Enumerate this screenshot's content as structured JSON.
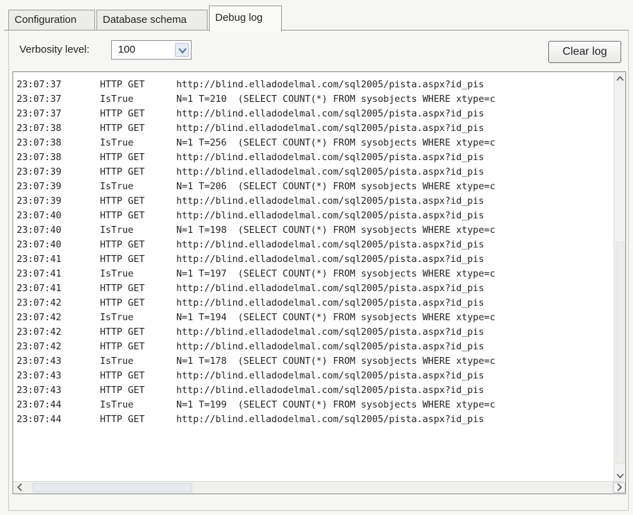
{
  "tabs": [
    {
      "label": "Configuration"
    },
    {
      "label": "Database schema"
    },
    {
      "label": "Debug log"
    }
  ],
  "verbosity": {
    "label": "Verbosity level:",
    "value": "100"
  },
  "clear_button": {
    "label": "Clear log"
  },
  "log": [
    {
      "time": "23:07:37",
      "kind": "HTTP GET",
      "msg": "http://blind.elladodelmal.com/sql2005/pista.aspx?id_pis"
    },
    {
      "time": "23:07:37",
      "kind": "IsTrue",
      "msg": "N=1 T=210  (SELECT COUNT(*) FROM sysobjects WHERE xtype=c"
    },
    {
      "time": "23:07:37",
      "kind": "HTTP GET",
      "msg": "http://blind.elladodelmal.com/sql2005/pista.aspx?id_pis"
    },
    {
      "time": "23:07:38",
      "kind": "HTTP GET",
      "msg": "http://blind.elladodelmal.com/sql2005/pista.aspx?id_pis"
    },
    {
      "time": "23:07:38",
      "kind": "IsTrue",
      "msg": "N=1 T=256  (SELECT COUNT(*) FROM sysobjects WHERE xtype=c"
    },
    {
      "time": "23:07:38",
      "kind": "HTTP GET",
      "msg": "http://blind.elladodelmal.com/sql2005/pista.aspx?id_pis"
    },
    {
      "time": "23:07:39",
      "kind": "HTTP GET",
      "msg": "http://blind.elladodelmal.com/sql2005/pista.aspx?id_pis"
    },
    {
      "time": "23:07:39",
      "kind": "IsTrue",
      "msg": "N=1 T=206  (SELECT COUNT(*) FROM sysobjects WHERE xtype=c"
    },
    {
      "time": "23:07:39",
      "kind": "HTTP GET",
      "msg": "http://blind.elladodelmal.com/sql2005/pista.aspx?id_pis"
    },
    {
      "time": "23:07:40",
      "kind": "HTTP GET",
      "msg": "http://blind.elladodelmal.com/sql2005/pista.aspx?id_pis"
    },
    {
      "time": "23:07:40",
      "kind": "IsTrue",
      "msg": "N=1 T=198  (SELECT COUNT(*) FROM sysobjects WHERE xtype=c"
    },
    {
      "time": "23:07:40",
      "kind": "HTTP GET",
      "msg": "http://blind.elladodelmal.com/sql2005/pista.aspx?id_pis"
    },
    {
      "time": "23:07:41",
      "kind": "HTTP GET",
      "msg": "http://blind.elladodelmal.com/sql2005/pista.aspx?id_pis"
    },
    {
      "time": "23:07:41",
      "kind": "IsTrue",
      "msg": "N=1 T=197  (SELECT COUNT(*) FROM sysobjects WHERE xtype=c"
    },
    {
      "time": "23:07:41",
      "kind": "HTTP GET",
      "msg": "http://blind.elladodelmal.com/sql2005/pista.aspx?id_pis"
    },
    {
      "time": "23:07:42",
      "kind": "HTTP GET",
      "msg": "http://blind.elladodelmal.com/sql2005/pista.aspx?id_pis"
    },
    {
      "time": "23:07:42",
      "kind": "IsTrue",
      "msg": "N=1 T=194  (SELECT COUNT(*) FROM sysobjects WHERE xtype=c"
    },
    {
      "time": "23:07:42",
      "kind": "HTTP GET",
      "msg": "http://blind.elladodelmal.com/sql2005/pista.aspx?id_pis"
    },
    {
      "time": "23:07:42",
      "kind": "HTTP GET",
      "msg": "http://blind.elladodelmal.com/sql2005/pista.aspx?id_pis"
    },
    {
      "time": "23:07:43",
      "kind": "IsTrue",
      "msg": "N=1 T=178  (SELECT COUNT(*) FROM sysobjects WHERE xtype=c"
    },
    {
      "time": "23:07:43",
      "kind": "HTTP GET",
      "msg": "http://blind.elladodelmal.com/sql2005/pista.aspx?id_pis"
    },
    {
      "time": "23:07:43",
      "kind": "HTTP GET",
      "msg": "http://blind.elladodelmal.com/sql2005/pista.aspx?id_pis"
    },
    {
      "time": "23:07:44",
      "kind": "IsTrue",
      "msg": "N=1 T=199  (SELECT COUNT(*) FROM sysobjects WHERE xtype=c"
    },
    {
      "time": "23:07:44",
      "kind": "HTTP GET",
      "msg": "http://blind.elladodelmal.com/sql2005/pista.aspx?id_pis"
    }
  ],
  "icons": {
    "dropdown": "chevron-down-icon",
    "scroll_up": "chevron-up-icon",
    "scroll_down": "chevron-down-icon",
    "scroll_left": "chevron-left-icon",
    "scroll_right": "chevron-right-icon"
  },
  "colors": {
    "background": "#f6f6f4",
    "log_background": "#ffffff",
    "text": "#222222",
    "dropdown_arrow": "#4a6fa5"
  }
}
